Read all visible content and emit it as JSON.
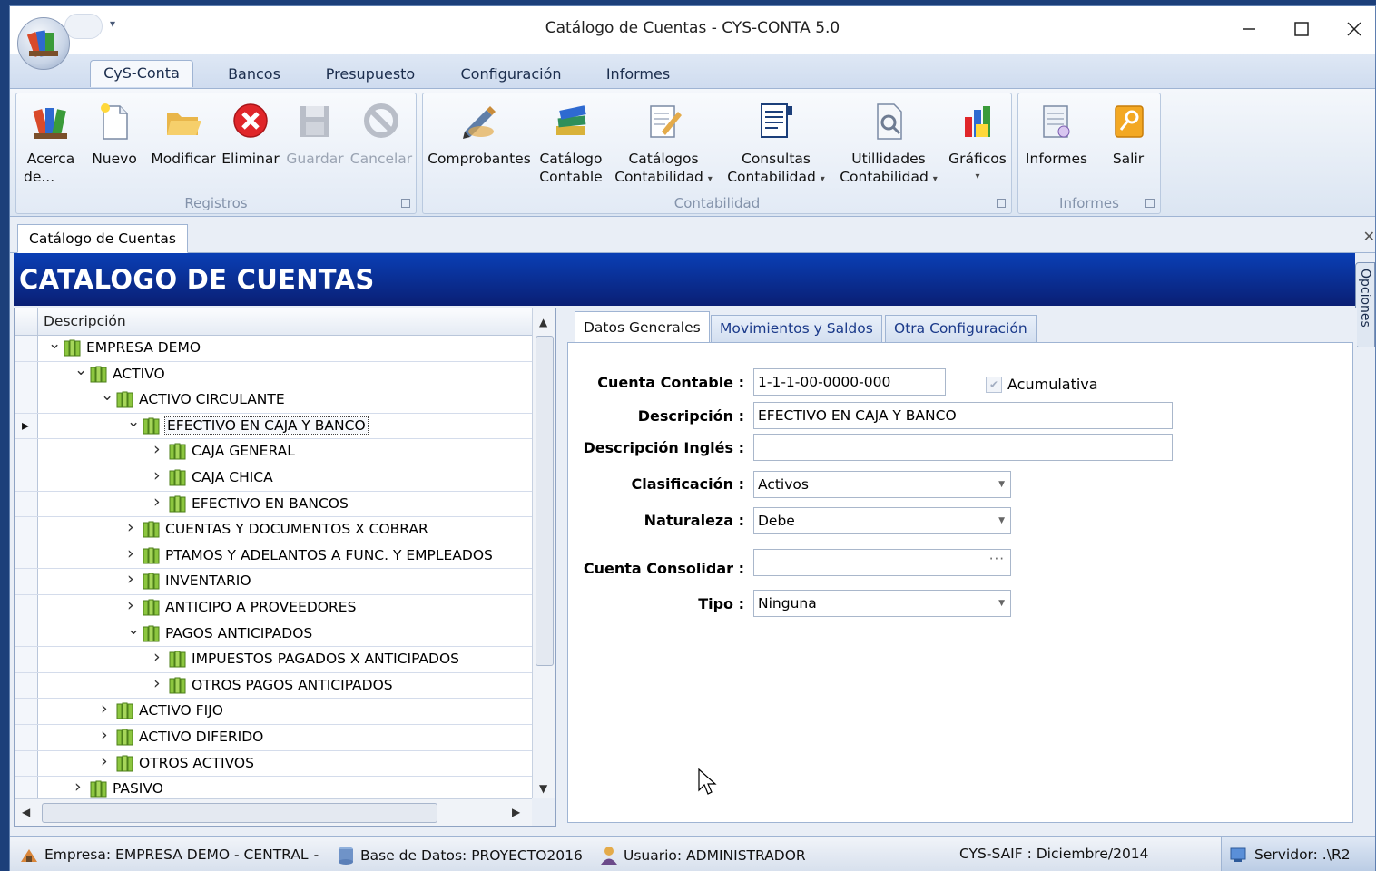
{
  "window": {
    "title": "Catálogo de Cuentas - CYS-CONTA 5.0"
  },
  "ribbon_tabs": [
    "CyS-Conta",
    "Bancos",
    "Presupuesto",
    "Configuración",
    "Informes"
  ],
  "ribbon": {
    "groups": {
      "registros": "Registros",
      "contabilidad": "Contabilidad",
      "informes": "Informes"
    },
    "buttons": {
      "acerca": "Acerca de...",
      "acerca_l1": "Acerca",
      "acerca_l2": "de...",
      "nuevo": "Nuevo",
      "modificar": "Modificar",
      "eliminar": "Eliminar",
      "guardar": "Guardar",
      "cancelar": "Cancelar",
      "comprobantes": "Comprobantes",
      "catalogo_l1": "Catálogo",
      "catalogo_l2": "Contable",
      "catalogos_l1": "Catálogos",
      "catalogos_l2": "Contabilidad",
      "consultas_l1": "Consultas",
      "consultas_l2": "Contabilidad",
      "utilidades_l1": "Utillidades",
      "utilidades_l2": "Contabilidad",
      "graficos": "Gráficos",
      "informes": "Informes",
      "salir": "Salir"
    }
  },
  "doc_tab": {
    "label": "Catálogo de Cuentas"
  },
  "banner": {
    "title": "CATALOGO DE CUENTAS"
  },
  "side_panel": {
    "label": "Opciones"
  },
  "tree": {
    "header": "Descripción",
    "rows": [
      {
        "label": "EMPRESA DEMO",
        "level": 1,
        "expanded": true
      },
      {
        "label": "ACTIVO",
        "level": 2,
        "expanded": true
      },
      {
        "label": "ACTIVO CIRCULANTE",
        "level": 3,
        "expanded": true
      },
      {
        "label": "EFECTIVO EN CAJA Y BANCO",
        "level": 4,
        "expanded": true,
        "selected": true
      },
      {
        "label": "CAJA GENERAL",
        "level": 5,
        "expanded": false
      },
      {
        "label": "CAJA CHICA",
        "level": 5,
        "expanded": false
      },
      {
        "label": "EFECTIVO EN BANCOS",
        "level": 5,
        "expanded": false
      },
      {
        "label": "CUENTAS Y DOCUMENTOS X COBRAR",
        "level": 4,
        "expanded": false
      },
      {
        "label": "PTAMOS Y ADELANTOS A FUNC. Y EMPLEADOS",
        "level": 4,
        "expanded": false
      },
      {
        "label": "INVENTARIO",
        "level": 4,
        "expanded": false
      },
      {
        "label": "ANTICIPO A PROVEEDORES",
        "level": 4,
        "expanded": false
      },
      {
        "label": "PAGOS ANTICIPADOS",
        "level": 4,
        "expanded": true
      },
      {
        "label": "IMPUESTOS PAGADOS X ANTICIPADOS",
        "level": 5,
        "expanded": false
      },
      {
        "label": "OTROS PAGOS ANTICIPADOS",
        "level": 5,
        "expanded": false
      },
      {
        "label": "ACTIVO FIJO",
        "level": 3,
        "expanded": false
      },
      {
        "label": "ACTIVO DIFERIDO",
        "level": 3,
        "expanded": false
      },
      {
        "label": "OTROS ACTIVOS",
        "level": 3,
        "expanded": false
      },
      {
        "label": "PASIVO",
        "level": 2,
        "expanded": false
      }
    ]
  },
  "detail_tabs": [
    "Datos Generales",
    "Movimientos y Saldos",
    "Otra Configuración"
  ],
  "form": {
    "cuenta_contable": {
      "label": "Cuenta Contable :",
      "value": "1-1-1-00-0000-000"
    },
    "acumulativa": {
      "label": "Acumulativa",
      "checked": true
    },
    "descripcion": {
      "label": "Descripción :",
      "value": "EFECTIVO EN CAJA Y BANCO"
    },
    "descripcion_ingles": {
      "label": "Descripción Inglés :",
      "value": ""
    },
    "clasificacion": {
      "label": "Clasificación :",
      "value": "Activos"
    },
    "naturaleza": {
      "label": "Naturaleza :",
      "value": "Debe"
    },
    "cuenta_consolidar": {
      "label": "Cuenta Consolidar :",
      "value": ""
    },
    "tipo": {
      "label": "Tipo :",
      "value": "Ninguna"
    }
  },
  "status": {
    "empresa": "Empresa: EMPRESA DEMO - CENTRAL",
    "sep": "-",
    "base": "Base de Datos: PROYECTO2016",
    "usuario": "Usuario: ADMINISTRADOR",
    "saif": "CYS-SAIF : Diciembre/2014",
    "servidor": "Servidor: .\\R2"
  },
  "colors": {
    "banner": "#0a2f9a",
    "accent": "#1b3a8a",
    "close": "#e0262a"
  }
}
